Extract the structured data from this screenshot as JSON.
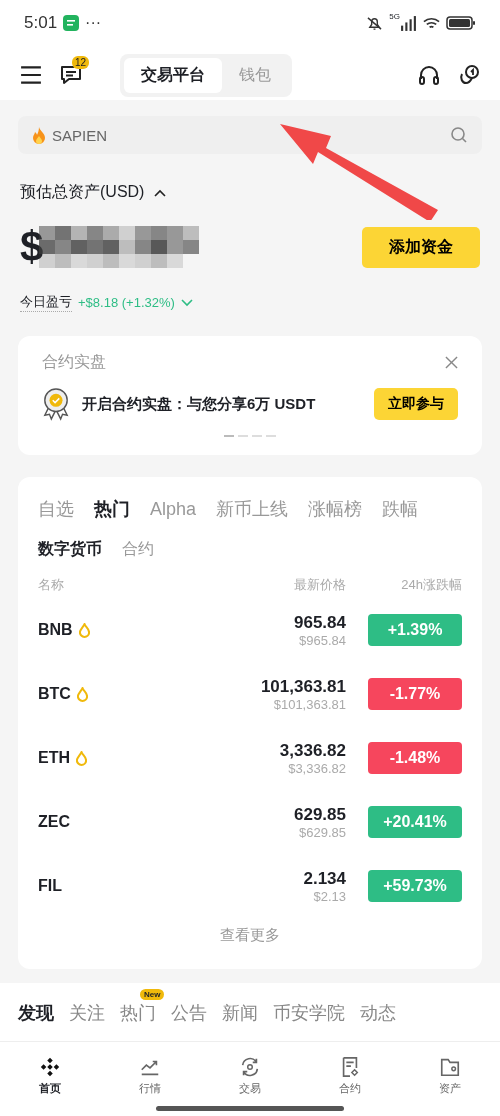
{
  "status_bar": {
    "time": "5:01",
    "more": "···",
    "network": "5G"
  },
  "header": {
    "badge": "12",
    "segments": [
      {
        "label": "交易平台",
        "selected": true
      },
      {
        "label": "钱包",
        "selected": false
      }
    ]
  },
  "search": {
    "placeholder": "SAPIEN"
  },
  "assets": {
    "label": "预估总资产(USD)",
    "amount": "$",
    "add_funds": "添加资金",
    "pnl_label": "今日盈亏",
    "pnl_value": "+$8.18 (+1.32%)"
  },
  "promo": {
    "title": "合约实盘",
    "text": "开启合约实盘：与您分享6万 USDT",
    "button": "立即参与",
    "pages": [
      {
        "selected": true
      },
      {
        "selected": false
      },
      {
        "selected": false
      },
      {
        "selected": false
      }
    ]
  },
  "market": {
    "tabs": [
      {
        "label": "自选",
        "selected": false
      },
      {
        "label": "热门",
        "selected": true
      },
      {
        "label": "Alpha",
        "selected": false
      },
      {
        "label": "新币上线",
        "selected": false
      },
      {
        "label": "涨幅榜",
        "selected": false
      },
      {
        "label": "跌幅",
        "selected": false
      }
    ],
    "subtabs": [
      {
        "label": "数字货币",
        "selected": true
      },
      {
        "label": "合约",
        "selected": false
      }
    ],
    "columns": [
      "名称",
      "最新价格",
      "24h涨跌幅"
    ],
    "rows": [
      {
        "symbol": "BNB",
        "hot": true,
        "price": "965.84",
        "price_usd": "$965.84",
        "change": "+1.39%",
        "color": "#2ebd85"
      },
      {
        "symbol": "BTC",
        "hot": true,
        "price": "101,363.81",
        "price_usd": "$101,363.81",
        "change": "-1.77%",
        "color": "#f6465d"
      },
      {
        "symbol": "ETH",
        "hot": true,
        "price": "3,336.82",
        "price_usd": "$3,336.82",
        "change": "-1.48%",
        "color": "#f6465d"
      },
      {
        "symbol": "ZEC",
        "hot": false,
        "price": "629.85",
        "price_usd": "$629.85",
        "change": "+20.41%",
        "color": "#2ebd85"
      },
      {
        "symbol": "FIL",
        "hot": false,
        "price": "2.134",
        "price_usd": "$2.13",
        "change": "+59.73%",
        "color": "#2ebd85"
      }
    ],
    "more": "查看更多"
  },
  "feed_tabs": [
    {
      "label": "发现",
      "selected": true
    },
    {
      "label": "关注",
      "selected": false
    },
    {
      "label": "热门",
      "selected": false,
      "badge": "New"
    },
    {
      "label": "公告",
      "selected": false
    },
    {
      "label": "新闻",
      "selected": false
    },
    {
      "label": "币安学院",
      "selected": false
    },
    {
      "label": "动态",
      "selected": false
    }
  ],
  "bottom_nav": [
    {
      "label": "首页",
      "kind": "home",
      "selected": true
    },
    {
      "label": "行情",
      "kind": "markets",
      "selected": false
    },
    {
      "label": "交易",
      "kind": "trade",
      "selected": false
    },
    {
      "label": "合约",
      "kind": "futures",
      "selected": false
    },
    {
      "label": "资产",
      "kind": "assets",
      "selected": false
    }
  ]
}
